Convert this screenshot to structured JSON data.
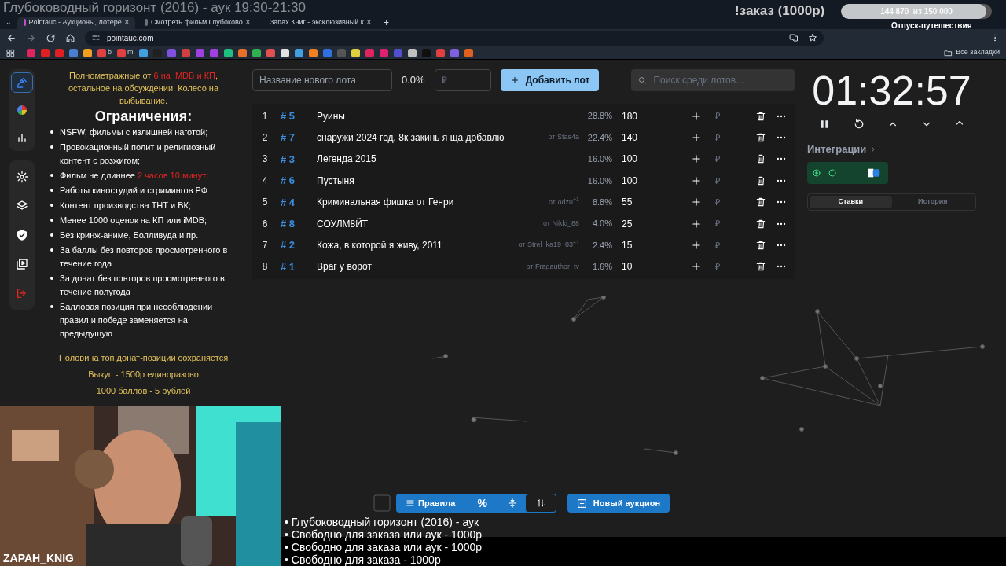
{
  "browser": {
    "tab_list_button": "⌄",
    "tabs": [
      {
        "title": "Pointauc - Аукционы, лотере",
        "close": "×",
        "selected": true
      },
      {
        "title": "Смотреть фильм Глубоково",
        "close": "×",
        "selected": false
      },
      {
        "title": "Запах Книг - эксклюзивный к",
        "close": "×",
        "selected": false
      }
    ],
    "new_tab": "+",
    "url": "pointauc.com",
    "bookmark_labels": [
      "b",
      "m"
    ],
    "all_bookmarks": "Все закладки"
  },
  "stream_overlay": {
    "title": "Глубоководный горизонт (2016) - аук 19:30-21:30",
    "order_note": "!заказ (1000р)",
    "goal": {
      "reading": "144 870  из 150 000",
      "level": 0.966,
      "label": "Отпуск-путешествия"
    },
    "webcam_name": "ZAPAH_KNIG",
    "queue": [
      "• Глубоководный горизонт (2016) - аук",
      "• Свободно для заказа или аук - 1000р",
      "• Свободно для заказа или аук - 1000р",
      "• Свободно для заказа - 1000р"
    ]
  },
  "sidebar": {
    "items": [
      {
        "kind": "gavel",
        "selected": true
      },
      {
        "kind": "pie",
        "selected": false
      },
      {
        "kind": "bars",
        "selected": false
      },
      {
        "kind": "gear",
        "selected": false
      },
      {
        "kind": "layers",
        "selected": false
      },
      {
        "kind": "shield",
        "selected": false
      },
      {
        "kind": "video",
        "selected": false
      },
      {
        "kind": "logout",
        "selected": false
      }
    ]
  },
  "rules": {
    "intro": [
      {
        "text": "Полнометражные от ",
        "highlight": false
      },
      {
        "text": "6 на IMDB и КП",
        "highlight": true
      },
      {
        "text": ", остальное на обсуждении. Колесо на выбывание.",
        "highlight": false
      }
    ],
    "heading": "Ограничения:",
    "items": [
      [
        {
          "text": "NSFW, фильмы с излишней наготой;",
          "highlight": false
        }
      ],
      [
        {
          "text": "Провокационный полит и религиозный контент с розжигом;",
          "highlight": false
        }
      ],
      [
        {
          "text": "Фильм не длиннее ",
          "highlight": false
        },
        {
          "text": "2 часов 10 минут;",
          "highlight": true
        }
      ],
      [
        {
          "text": "Работы киностудий и стримингов РФ",
          "highlight": false
        }
      ],
      [
        {
          "text": "Контент производства ТНТ и ВК;",
          "highlight": false
        }
      ],
      [
        {
          "text": "Менее 1000 оценок на КП или iMDB;",
          "highlight": false
        }
      ],
      [
        {
          "text": "Без кринж-аниме, Болливуда и пр.",
          "highlight": false
        }
      ],
      [
        {
          "text": "За баллы без повторов просмотренного в течение года",
          "highlight": false
        }
      ],
      [
        {
          "text": "За донат без повторов просмотренного в течение полугода",
          "highlight": false
        }
      ],
      [
        {
          "text": "Балловая позиция при несоблюдении правил и победе заменяется на предыдущую",
          "highlight": false
        }
      ]
    ],
    "footer": [
      "Половина топ донат-позиции сохраняется",
      "Выкуп - 1500р единоразово",
      "1000 баллов - 5 рублей"
    ]
  },
  "lot_form": {
    "name_placeholder": "Название нового лота",
    "percent": "0.0%",
    "amount_placeholder": "₽",
    "add_button": "Добавить лот",
    "search_placeholder": "Поиск среди лотов..."
  },
  "lots": [
    {
      "rank": "1",
      "id": "# 5",
      "name": "Руины",
      "percent": "28.8%",
      "amount": "180",
      "currency": "₽"
    },
    {
      "rank": "2",
      "id": "# 7",
      "name": "снаружи 2024 год. 8к закинь я ща добавлю",
      "author": "от Stas4a",
      "percent": "22.4%",
      "amount": "140",
      "currency": "₽"
    },
    {
      "rank": "3",
      "id": "# 3",
      "name": "Легенда 2015",
      "percent": "16.0%",
      "amount": "100",
      "currency": "₽"
    },
    {
      "rank": "4",
      "id": "# 6",
      "name": "Пустыня",
      "percent": "16.0%",
      "amount": "100",
      "currency": "₽"
    },
    {
      "rank": "5",
      "id": "# 4",
      "name": "Криминальная фишка от Генри",
      "author": "от odzu",
      "extra": "+1",
      "percent": "8.8%",
      "amount": "55",
      "currency": "₽"
    },
    {
      "rank": "6",
      "id": "# 8",
      "name": "СОУЛМ8ЙТ",
      "author": "от Nikki_88",
      "percent": "4.0%",
      "amount": "25",
      "currency": "₽"
    },
    {
      "rank": "7",
      "id": "# 2",
      "name": "Кожа, в которой я живу, 2011",
      "author": "от Strel_ka19_83",
      "extra": "+1",
      "percent": "2.4%",
      "amount": "15",
      "currency": "₽"
    },
    {
      "rank": "8",
      "id": "# 1",
      "name": "Враг у ворот",
      "author": "от Fragauthor_tv",
      "percent": "1.6%",
      "amount": "10",
      "currency": "₽"
    }
  ],
  "timer": {
    "time": "01:32:57",
    "integrations": "Интеграции",
    "integration_states": [
      {
        "kind": "active"
      },
      {
        "kind": "loading"
      }
    ],
    "tabs": [
      {
        "label": "Ставки",
        "selected": true
      },
      {
        "label": "История",
        "selected": false
      }
    ]
  },
  "toolbar": {
    "rules_button": "Правила",
    "percent_button": "%",
    "new_auction": "Новый аукцион"
  }
}
